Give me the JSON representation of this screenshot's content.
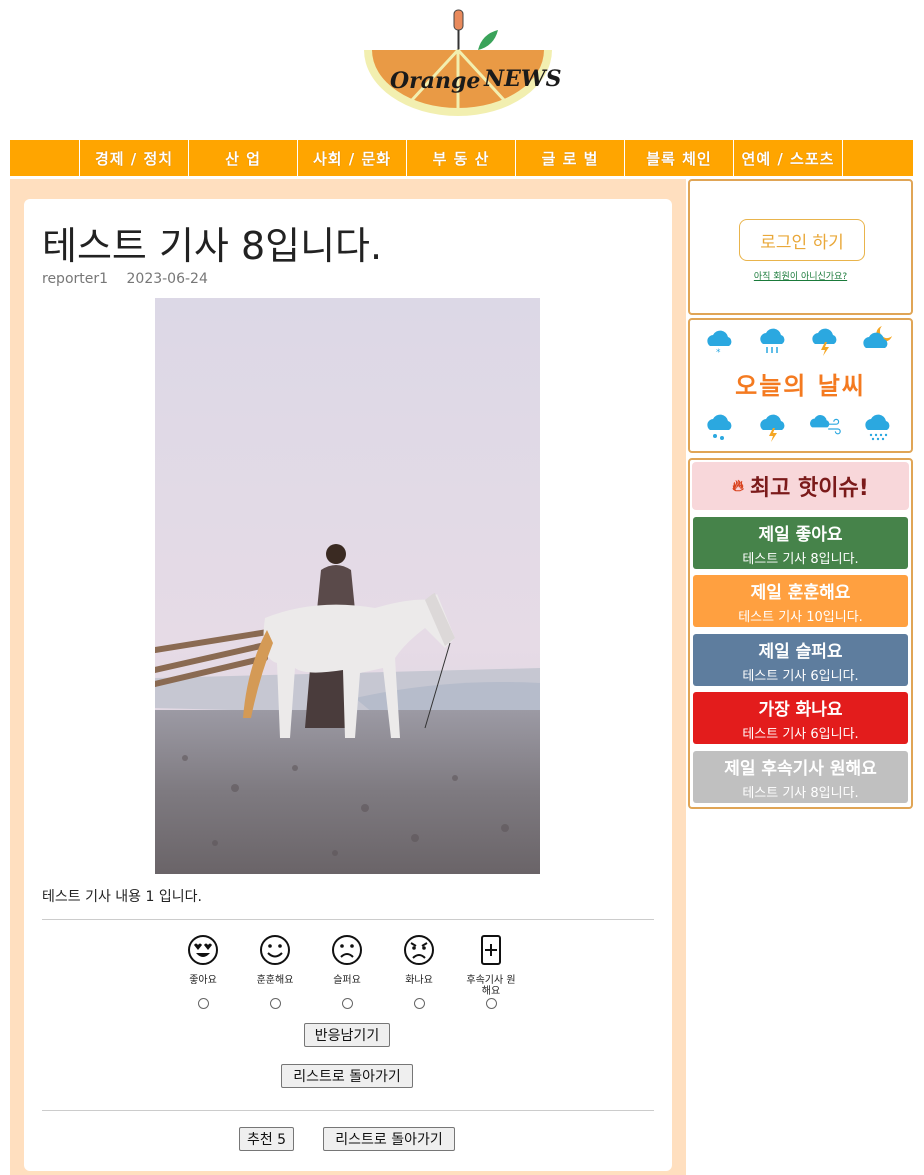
{
  "logo": {
    "word1": "Orange",
    "word2": "NEWS"
  },
  "nav": {
    "items": [
      "경제 / 정치",
      "산 업",
      "사회 / 문화",
      "부 동 산",
      "글 로 벌",
      "블록 체인",
      "연예 / 스포츠"
    ]
  },
  "article": {
    "title": "테스트 기사 8입니다.",
    "author": "reporter1",
    "date": "2023-06-24",
    "body": "테스트 기사 내용 1 입니다."
  },
  "reactions": {
    "items": [
      {
        "label": "좋아요",
        "icon": "heart-eyes-face-icon"
      },
      {
        "label": "훈훈해요",
        "icon": "smile-face-icon"
      },
      {
        "label": "슬퍼요",
        "icon": "sad-face-icon"
      },
      {
        "label": "화나요",
        "icon": "angry-face-icon"
      },
      {
        "label": "후속기사 원해요",
        "icon": "plus-document-icon"
      }
    ],
    "submit_label": "반응남기기",
    "back_label": "리스트로 돌아가기"
  },
  "footer": {
    "recommend_label": "추천 5",
    "back_label": "리스트로 돌아가기"
  },
  "sidebar": {
    "login_label": "로그인 하기",
    "signup_text": "아직 회원이 아니신가요?",
    "weather_title": "오늘의 날씨",
    "hot_title": "최고 핫이슈!",
    "hot_items": [
      {
        "heading": "제일 좋아요",
        "article": "테스트 기사 8입니다.",
        "color": "#46834a"
      },
      {
        "heading": "제일 훈훈해요",
        "article": "테스트 기사 10입니다.",
        "color": "#ffa040"
      },
      {
        "heading": "제일 슬퍼요",
        "article": "테스트 기사 6입니다.",
        "color": "#5e7d9e"
      },
      {
        "heading": "가장 화나요",
        "article": "테스트 기사 6입니다.",
        "color": "#e31c1c"
      },
      {
        "heading": "제일 후속기사 원해요",
        "article": "테스트 기사 8입니다.",
        "color": "#c0c0c0"
      }
    ]
  },
  "colors": {
    "accent": "#ffa500",
    "panel_bg": "#ffdfbf",
    "sidebar_border": "#e0a556"
  }
}
